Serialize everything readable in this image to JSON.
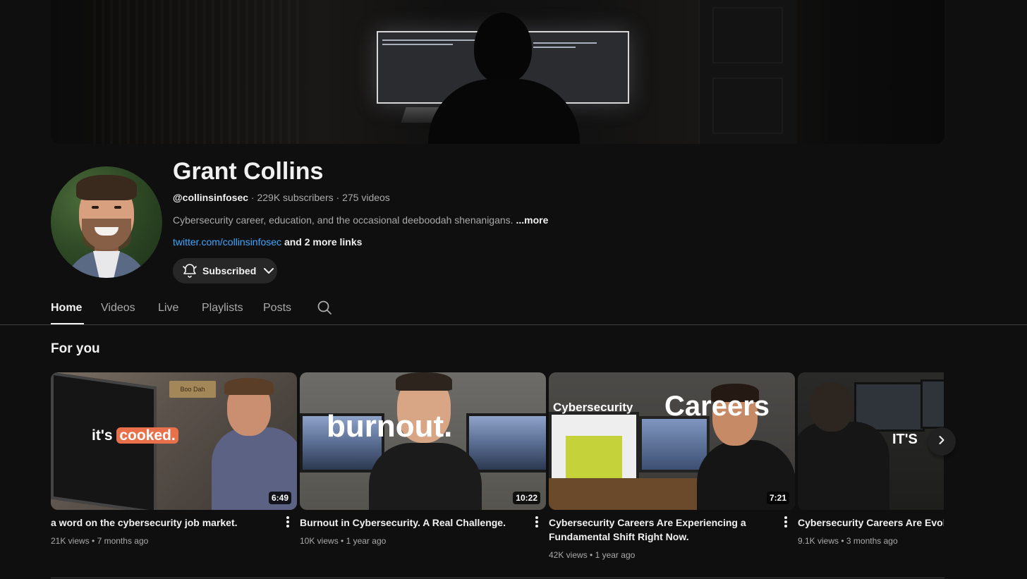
{
  "channel": {
    "name": "Grant Collins",
    "handle": "@collinsinfosec",
    "subscribers": "229K subscribers",
    "videos_count": "275 videos",
    "separator": " · ",
    "description": "Cybersecurity career, education, and the occasional deeboodah shenanigans.",
    "description_more": "...more",
    "link": "twitter.com/collinsinfosec",
    "more_links": "and 2 more links",
    "subscribe_label": "Subscribed"
  },
  "tabs": [
    {
      "label": "Home",
      "active": true
    },
    {
      "label": "Videos",
      "active": false
    },
    {
      "label": "Live",
      "active": false
    },
    {
      "label": "Playlists",
      "active": false
    },
    {
      "label": "Posts",
      "active": false
    }
  ],
  "section": {
    "title": "For you"
  },
  "videos": [
    {
      "title": "a word on the cybersecurity job market.",
      "views": "21K views",
      "age": "7 months ago",
      "duration": "6:49",
      "overlay_prefix": "it's",
      "overlay_highlight": "cooked.",
      "sign_text": "Boo Dah"
    },
    {
      "title": "Burnout in Cybersecurity. A Real Challenge.",
      "views": "10K views",
      "age": "1 year ago",
      "duration": "10:22",
      "overlay_text": "burnout."
    },
    {
      "title": "Cybersecurity Careers Are Experiencing a Fundamental Shift Right Now.",
      "views": "42K views",
      "age": "1 year ago",
      "duration": "7:21",
      "overlay_small": "Cybersecurity",
      "overlay_big": "Careers"
    },
    {
      "title": "Cybersecurity Careers Are Evolvin",
      "views": "9.1K views",
      "age": "3 months ago",
      "overlay_text": "IT'S"
    }
  ],
  "meta_separator": " • ",
  "colors": {
    "background": "#0f0f0f",
    "link": "#3ea6ff",
    "secondary_text": "#aaaaaa",
    "button_bg": "#272727",
    "highlight": "#e8704b"
  }
}
